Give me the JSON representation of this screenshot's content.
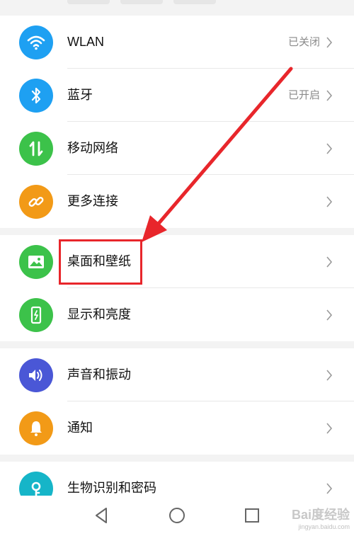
{
  "settings_groups": [
    {
      "items": [
        {
          "label": "WLAN",
          "status": "已关闭",
          "icon": "wifi-icon",
          "color": "#1ea0f2"
        },
        {
          "label": "蓝牙",
          "status": "已开启",
          "icon": "bluetooth-icon",
          "color": "#1ea0f2"
        },
        {
          "label": "移动网络",
          "status": "",
          "icon": "mobile-data-icon",
          "color": "#3cc24a"
        },
        {
          "label": "更多连接",
          "status": "",
          "icon": "link-icon",
          "color": "#f29a17"
        }
      ]
    },
    {
      "items": [
        {
          "label": "桌面和壁纸",
          "status": "",
          "icon": "wallpaper-icon",
          "color": "#3cc24a"
        },
        {
          "label": "显示和亮度",
          "status": "",
          "icon": "display-icon",
          "color": "#3cc24a"
        }
      ]
    },
    {
      "items": [
        {
          "label": "声音和振动",
          "status": "",
          "icon": "sound-icon",
          "color": "#4a57d6"
        },
        {
          "label": "通知",
          "status": "",
          "icon": "bell-icon",
          "color": "#f29a17"
        },
        {
          "label": "生物识别和密码",
          "status": "",
          "icon": "key-icon",
          "color": "#16b5c8"
        }
      ]
    }
  ],
  "watermark": {
    "brand": "Bai度经验",
    "url": "jingyan.baidu.com"
  },
  "annotation_color": "#e8262b"
}
